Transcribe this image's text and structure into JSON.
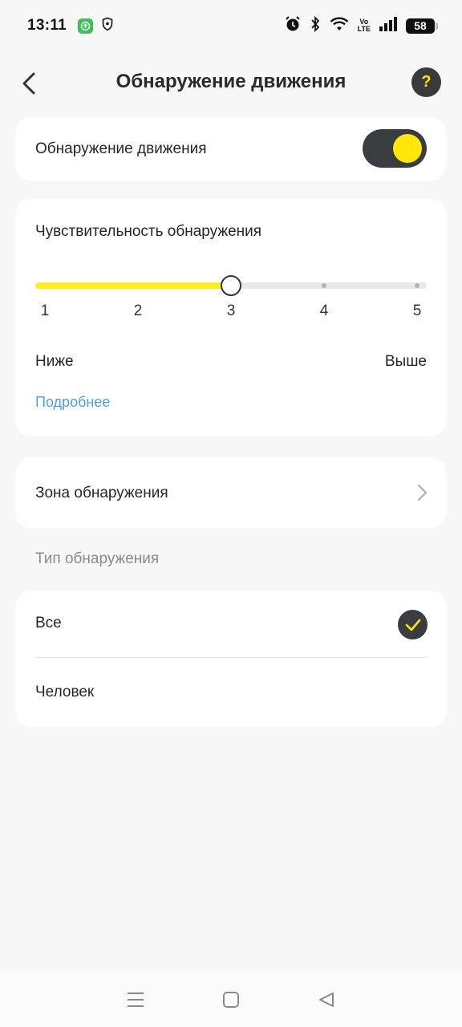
{
  "status_bar": {
    "time": "13:11",
    "battery": "58",
    "volte_top": "Vo",
    "volte_bottom": "LTE",
    "icons": [
      "green-app-icon",
      "shield-icon",
      "alarm-icon",
      "bluetooth-icon",
      "wifi-icon",
      "volte-icon",
      "signal-icon",
      "battery-icon"
    ]
  },
  "header": {
    "title": "Обнаружение движения",
    "help_label": "?"
  },
  "motion_detection": {
    "label": "Обнаружение движения",
    "enabled": true
  },
  "sensitivity": {
    "title": "Чувствительность обнаружения",
    "levels": [
      "1",
      "2",
      "3",
      "4",
      "5"
    ],
    "current_level": 3,
    "lower_label": "Ниже",
    "higher_label": "Выше",
    "more_link": "Подробнее"
  },
  "detection_zone": {
    "label": "Зона обнаружения"
  },
  "detection_type": {
    "section_title": "Тип обнаружения",
    "options": [
      {
        "label": "Все",
        "selected": true
      },
      {
        "label": "Человек",
        "selected": false
      }
    ]
  },
  "colors": {
    "accent": "#ffe70a",
    "dark": "#3a3d40",
    "link": "#4aa3d8"
  }
}
